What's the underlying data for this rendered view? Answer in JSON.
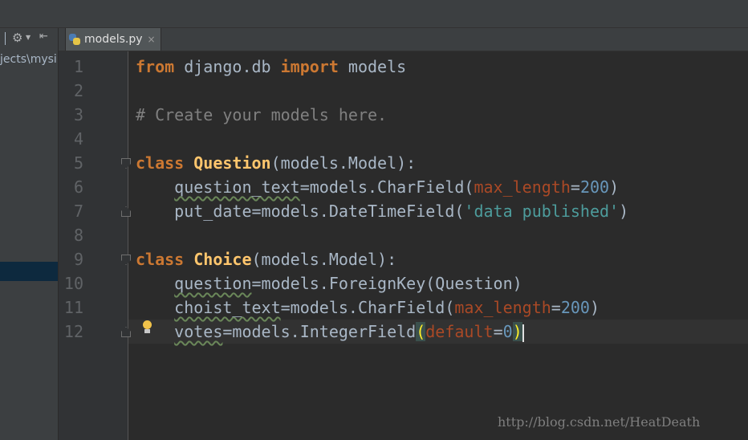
{
  "left_panel": {
    "project_path": "jects\\mysi",
    "icons": [
      "gear-icon",
      "dropdown-caret-icon",
      "collapse-icon"
    ]
  },
  "tab": {
    "file_name": "models.py",
    "close_glyph": "×",
    "icon": "python-file-icon"
  },
  "editor": {
    "line_numbers": [
      "1",
      "2",
      "3",
      "4",
      "5",
      "6",
      "7",
      "8",
      "9",
      "10",
      "11",
      "12"
    ],
    "lines": [
      [
        {
          "t": "from",
          "c": "kw"
        },
        {
          "t": " django.db "
        },
        {
          "t": "import",
          "c": "kw"
        },
        {
          "t": " models"
        }
      ],
      [],
      [
        {
          "t": "# Create your models here.",
          "c": "cmt"
        }
      ],
      [],
      [
        {
          "t": "class",
          "c": "kw"
        },
        {
          "t": " "
        },
        {
          "t": "Question",
          "c": "cls"
        },
        {
          "t": "(models.Model):"
        }
      ],
      [
        {
          "t": "    "
        },
        {
          "t": "question_text",
          "c": "err"
        },
        {
          "t": "=models.CharField("
        },
        {
          "t": "max_length",
          "c": "param"
        },
        {
          "t": "="
        },
        {
          "t": "200",
          "c": "num"
        },
        {
          "t": ")"
        }
      ],
      [
        {
          "t": "    put_date=models.DateTimeField("
        },
        {
          "t": "'data published'",
          "c": "str2"
        },
        {
          "t": ")"
        }
      ],
      [],
      [
        {
          "t": "class",
          "c": "kw"
        },
        {
          "t": " "
        },
        {
          "t": "Choice",
          "c": "cls"
        },
        {
          "t": "(models.Model):"
        }
      ],
      [
        {
          "t": "    "
        },
        {
          "t": "question",
          "c": "err"
        },
        {
          "t": "=models.ForeignKey(Question)"
        }
      ],
      [
        {
          "t": "    "
        },
        {
          "t": "choist_text",
          "c": "err"
        },
        {
          "t": "=models.CharField("
        },
        {
          "t": "max_length",
          "c": "param"
        },
        {
          "t": "="
        },
        {
          "t": "200",
          "c": "num"
        },
        {
          "t": ")"
        }
      ],
      [
        {
          "t": "    "
        },
        {
          "t": "votes",
          "c": "err"
        },
        {
          "t": "=models.IntegerField"
        },
        {
          "t": "(",
          "c": "brace-hl"
        },
        {
          "t": "default",
          "c": "param"
        },
        {
          "t": "="
        },
        {
          "t": "0",
          "c": "num"
        },
        {
          "t": ")",
          "c": "brace-hl"
        },
        {
          "t": "",
          "c": "caret"
        }
      ]
    ],
    "colors": {
      "keyword": "#cc7832",
      "class_name": "#ffc66d",
      "comment": "#808080",
      "string": "#4d9c9c",
      "number": "#6897bb",
      "parameter": "#aa4926",
      "text": "#a9b7c6",
      "background": "#2b2b2b"
    },
    "gutter_icons": [
      "fold-icon",
      "fold-end-icon",
      "lightbulb-icon"
    ]
  },
  "watermark": "http://blog.csdn.net/HeatDeath"
}
